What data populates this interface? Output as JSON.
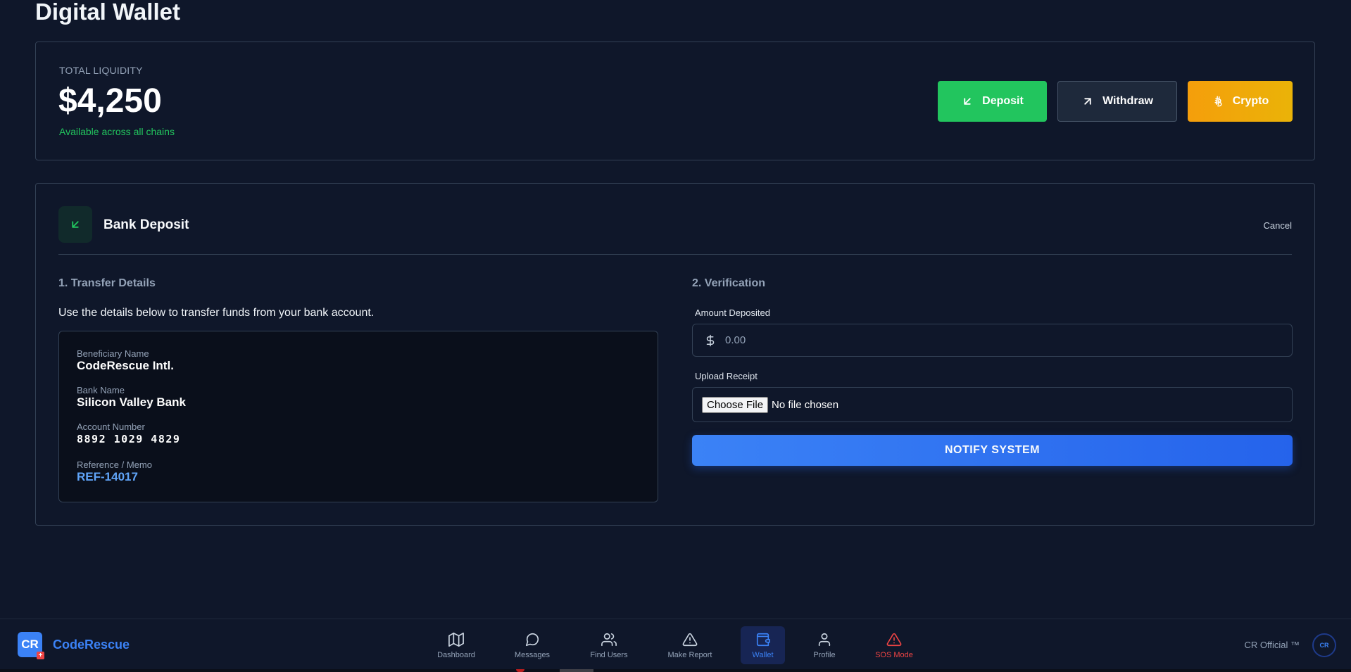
{
  "page": {
    "title": "Digital Wallet"
  },
  "liquidity": {
    "label": "TOTAL LIQUIDITY",
    "amount": "$4,250",
    "subtext": "Available across all chains"
  },
  "actions": {
    "deposit": "Deposit",
    "withdraw": "Withdraw",
    "crypto": "Crypto"
  },
  "deposit_panel": {
    "title": "Bank Deposit",
    "cancel": "Cancel",
    "transfer": {
      "heading": "1. Transfer Details",
      "description": "Use the details below to transfer funds from your bank account.",
      "beneficiary_label": "Beneficiary Name",
      "beneficiary_value": "CodeRescue Intl.",
      "bank_label": "Bank Name",
      "bank_value": "Silicon Valley Bank",
      "account_label": "Account Number",
      "account_value": "8892 1029 4829",
      "reference_label": "Reference / Memo",
      "reference_value": "REF-14017"
    },
    "verification": {
      "heading": "2. Verification",
      "amount_label": "Amount Deposited",
      "amount_placeholder": "0.00",
      "receipt_label": "Upload Receipt",
      "file_button": "Choose File",
      "file_status": "No file chosen",
      "submit": "NOTIFY SYSTEM"
    }
  },
  "bottom_nav": {
    "logo": "CR",
    "logo_badge": "+",
    "brand": "CodeRescue",
    "items": [
      {
        "label": "Dashboard",
        "icon": "map-icon"
      },
      {
        "label": "Messages",
        "icon": "message-circle-icon"
      },
      {
        "label": "Find Users",
        "icon": "users-icon"
      },
      {
        "label": "Make Report",
        "icon": "alert-triangle-icon"
      },
      {
        "label": "Wallet",
        "icon": "wallet-icon",
        "active": true
      },
      {
        "label": "Profile",
        "icon": "user-icon"
      },
      {
        "label": "SOS Mode",
        "icon": "alert-triangle-icon",
        "danger": true
      }
    ],
    "official": "CR Official ™",
    "avatar": "CR"
  },
  "colors": {
    "background": "#0f172a",
    "deposit_green": "#22c55e",
    "crypto_orange": "#f59e0b",
    "accent_blue": "#3b82f6",
    "danger_red": "#ef4444"
  }
}
